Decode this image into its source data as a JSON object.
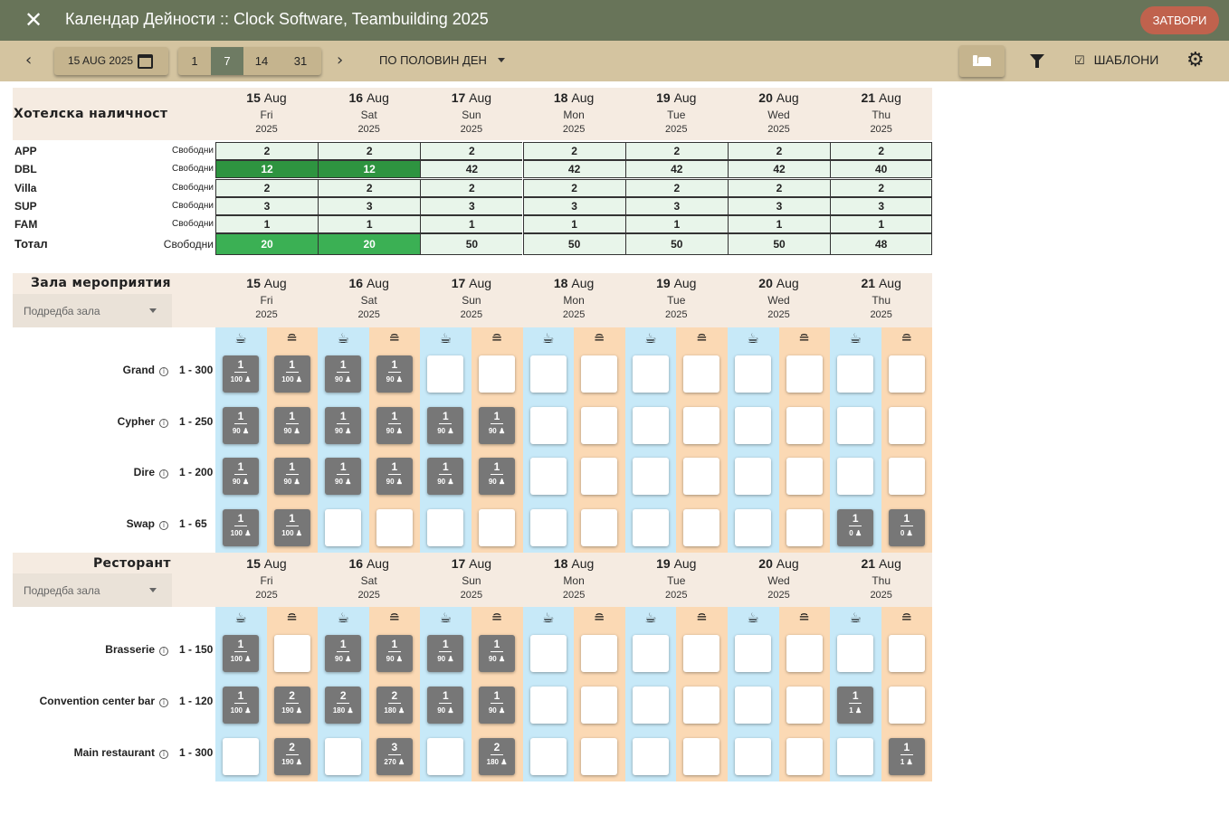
{
  "window": {
    "title": "Календар Дейности :: Clock Software, Teambuilding 2025",
    "close_label": "ЗАТВОРИ"
  },
  "toolbar": {
    "date": "15 AUG 2025",
    "span_options": [
      "1",
      "7",
      "14",
      "31"
    ],
    "span_selected": "7",
    "day_mode": "ПО ПОЛОВИН ДЕН",
    "templates_label": "ШАБЛОНИ"
  },
  "days": [
    {
      "day": "15",
      "month": "Aug",
      "weekday": "Fri",
      "year": "2025"
    },
    {
      "day": "16",
      "month": "Aug",
      "weekday": "Sat",
      "year": "2025"
    },
    {
      "day": "17",
      "month": "Aug",
      "weekday": "Sun",
      "year": "2025"
    },
    {
      "day": "18",
      "month": "Aug",
      "weekday": "Mon",
      "year": "2025"
    },
    {
      "day": "19",
      "month": "Aug",
      "weekday": "Tue",
      "year": "2025"
    },
    {
      "day": "20",
      "month": "Aug",
      "weekday": "Wed",
      "year": "2025"
    },
    {
      "day": "21",
      "month": "Aug",
      "weekday": "Thu",
      "year": "2025"
    }
  ],
  "hotel": {
    "title": "Хотелска наличност",
    "free_label": "Свободни",
    "rows": [
      {
        "type": "APP",
        "values": [
          2,
          2,
          2,
          2,
          2,
          2,
          2
        ]
      },
      {
        "type": "DBL",
        "values": [
          12,
          12,
          42,
          42,
          42,
          42,
          40
        ]
      },
      {
        "type": "Villa",
        "values": [
          2,
          2,
          2,
          2,
          2,
          2,
          2
        ]
      },
      {
        "type": "SUP",
        "values": [
          3,
          3,
          3,
          3,
          3,
          3,
          3
        ]
      },
      {
        "type": "FAM",
        "values": [
          1,
          1,
          1,
          1,
          1,
          1,
          1
        ]
      }
    ],
    "total": {
      "type": "Тотал",
      "values": [
        20,
        20,
        50,
        50,
        50,
        50,
        48
      ]
    }
  },
  "halls": {
    "title": "Зала мероприятия",
    "arrangement_placeholder": "Подредба зала",
    "rooms": [
      {
        "name": "Grand",
        "capacity": "1 - 300",
        "slots": [
          "1|100",
          "1|100",
          "1|90",
          "1|90",
          "",
          "",
          "",
          "",
          "",
          "",
          "",
          "",
          "",
          ""
        ]
      },
      {
        "name": "Cypher",
        "capacity": "1 - 250",
        "slots": [
          "1|90",
          "1|90",
          "1|90",
          "1|90",
          "1|90",
          "1|90",
          "",
          "",
          "",
          "",
          "",
          "",
          "",
          ""
        ]
      },
      {
        "name": "Dire",
        "capacity": "1 - 200",
        "slots": [
          "1|90",
          "1|90",
          "1|90",
          "1|90",
          "1|90",
          "1|90",
          "",
          "",
          "",
          "",
          "",
          "",
          "",
          ""
        ]
      },
      {
        "name": "Swap",
        "capacity": "1 - 65",
        "slots": [
          "1|100",
          "1|100",
          "",
          "",
          "",
          "",
          "",
          "",
          "",
          "",
          "",
          "",
          "1|0",
          "1|0"
        ]
      }
    ]
  },
  "restaurant": {
    "title": "Ресторант",
    "arrangement_placeholder": "Подредба зала",
    "rooms": [
      {
        "name": "Brasserie",
        "capacity": "1 - 150",
        "slots": [
          "1|100",
          "",
          "1|90",
          "1|90",
          "1|90",
          "1|90",
          "",
          "",
          "",
          "",
          "",
          "",
          "",
          ""
        ]
      },
      {
        "name": "Convention center bar",
        "capacity": "1 - 120",
        "slots": [
          "1|100",
          "2|190",
          "2|180",
          "2|180",
          "1|90",
          "1|90",
          "",
          "",
          "",
          "",
          "",
          "",
          "1|1",
          ""
        ]
      },
      {
        "name": "Main restaurant",
        "capacity": "1 - 300",
        "slots": [
          "",
          "2|190",
          "",
          "3|270",
          "",
          "2|180",
          "",
          "",
          "",
          "",
          "",
          "",
          "",
          "1|1"
        ]
      }
    ]
  },
  "meal_icons": [
    "coffee-cup-icon",
    "burger-icon"
  ],
  "colors": {
    "titlebar": "#687459",
    "toolbar": "#d4c4a0",
    "close_button": "#c0624d",
    "morning_column": "#c7e9f8",
    "afternoon_column": "#fbd9b4",
    "available_cell": "#e8f5ea",
    "low_availability": "#2e9440",
    "booked_slot": "#777777"
  }
}
